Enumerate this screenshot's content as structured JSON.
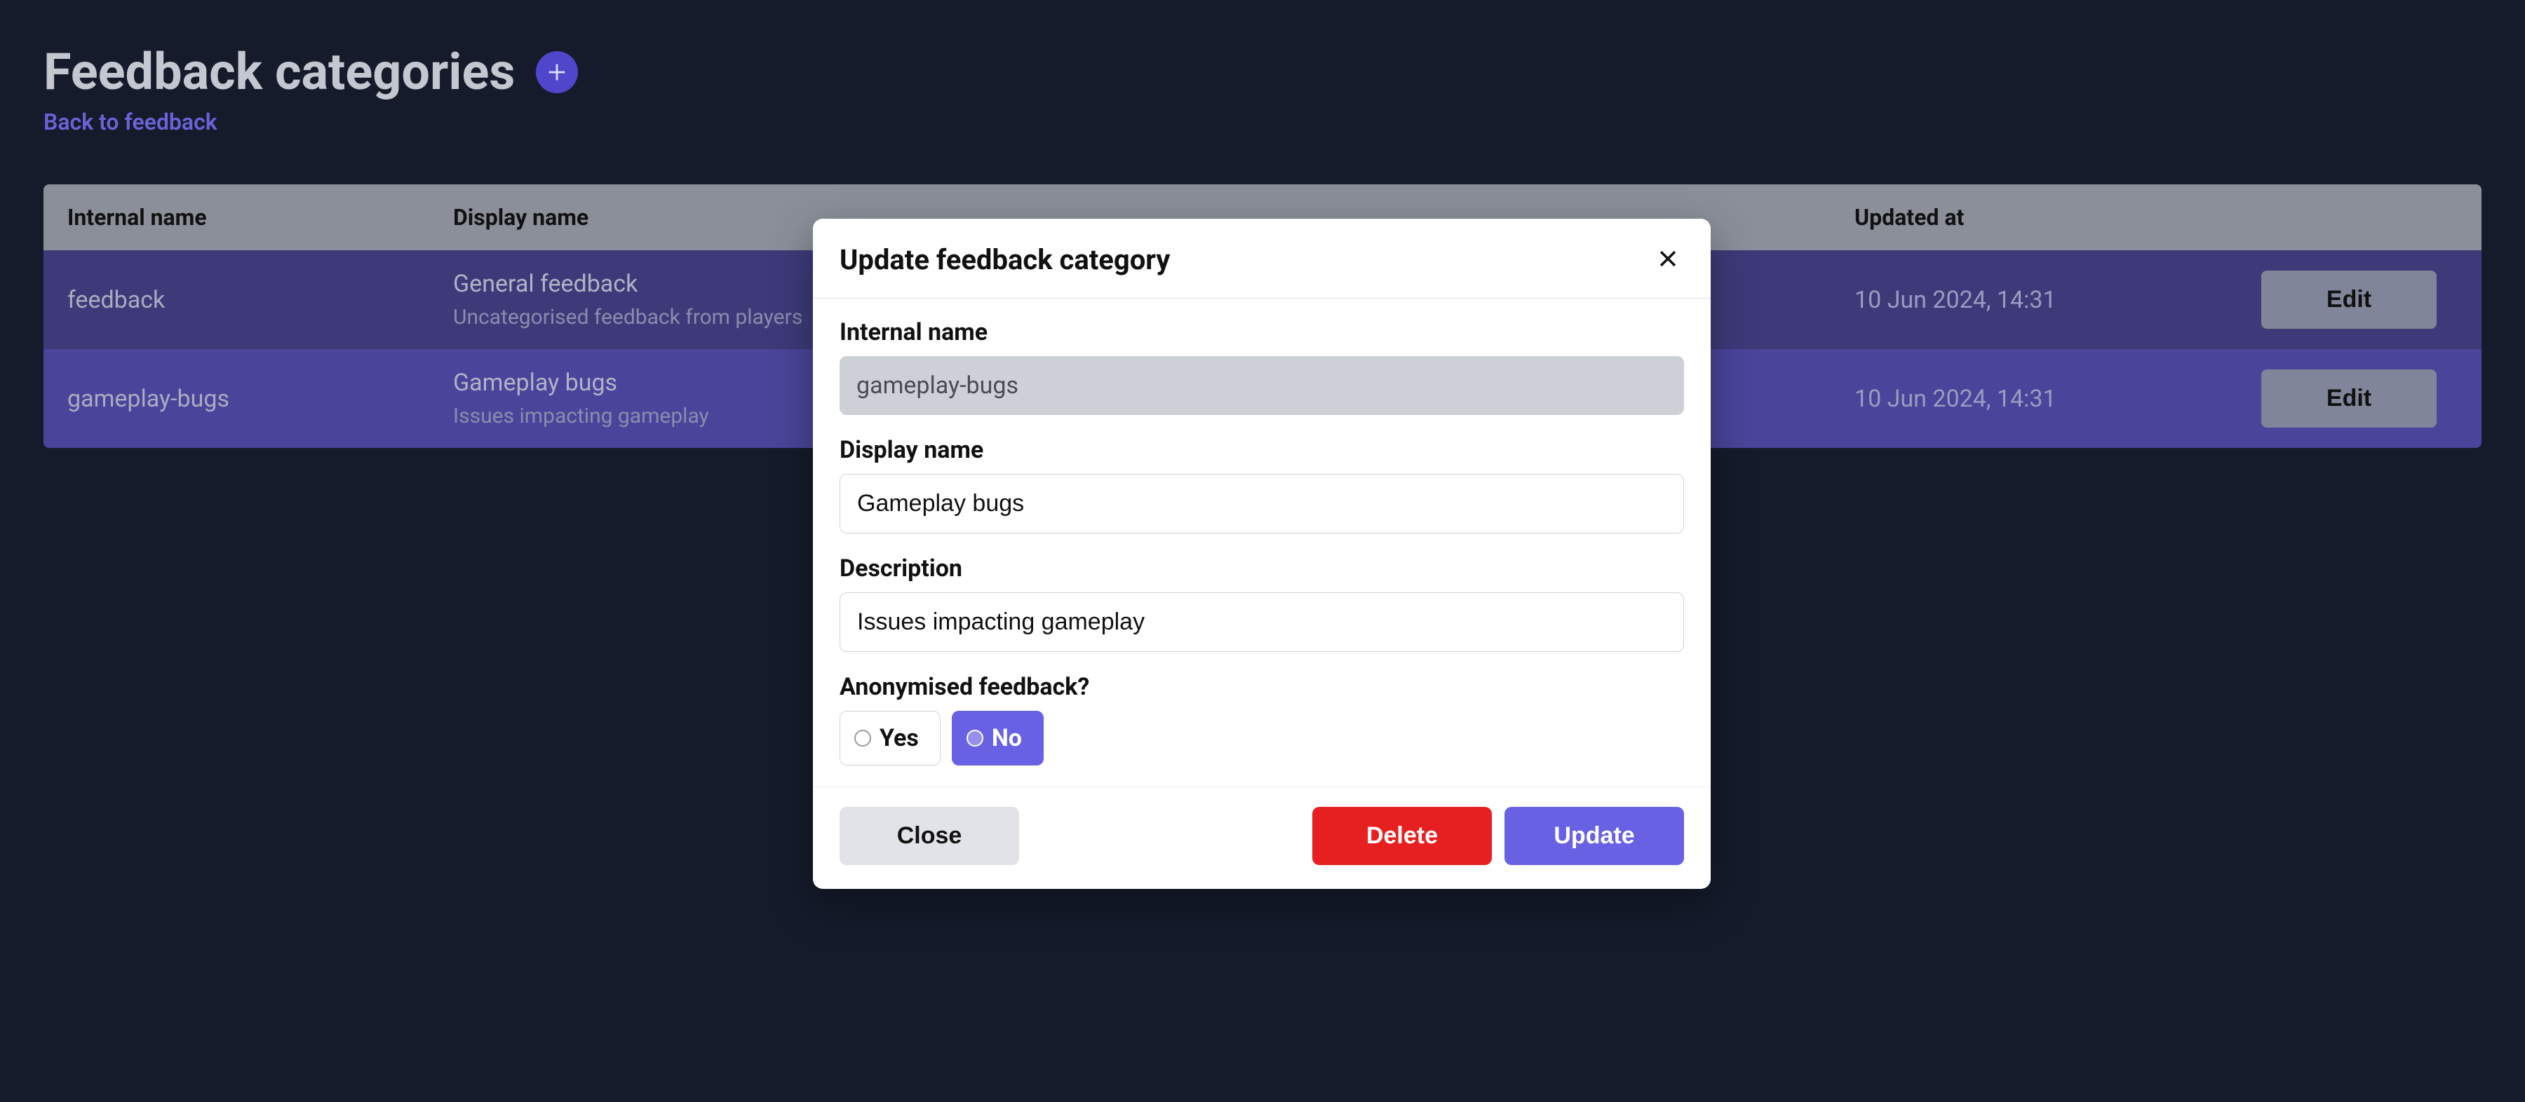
{
  "page": {
    "title": "Feedback categories",
    "back_link": "Back to feedback"
  },
  "table": {
    "headers": {
      "internal": "Internal name",
      "display": "Display name",
      "updated": "Updated at"
    },
    "rows": [
      {
        "internal": "feedback",
        "display": "General feedback",
        "description": "Uncategorised feedback from players",
        "updated": "10 Jun 2024, 14:31",
        "edit_label": "Edit"
      },
      {
        "internal": "gameplay-bugs",
        "display": "Gameplay bugs",
        "description": "Issues impacting gameplay",
        "updated": "10 Jun 2024, 14:31",
        "edit_label": "Edit"
      }
    ]
  },
  "modal": {
    "title": "Update feedback category",
    "labels": {
      "internal_name": "Internal name",
      "display_name": "Display name",
      "description": "Description",
      "anonymised": "Anonymised feedback?"
    },
    "values": {
      "internal_name": "gameplay-bugs",
      "display_name": "Gameplay bugs",
      "description": "Issues impacting gameplay"
    },
    "radio": {
      "yes": "Yes",
      "no": "No"
    },
    "buttons": {
      "close": "Close",
      "delete": "Delete",
      "update": "Update"
    }
  }
}
